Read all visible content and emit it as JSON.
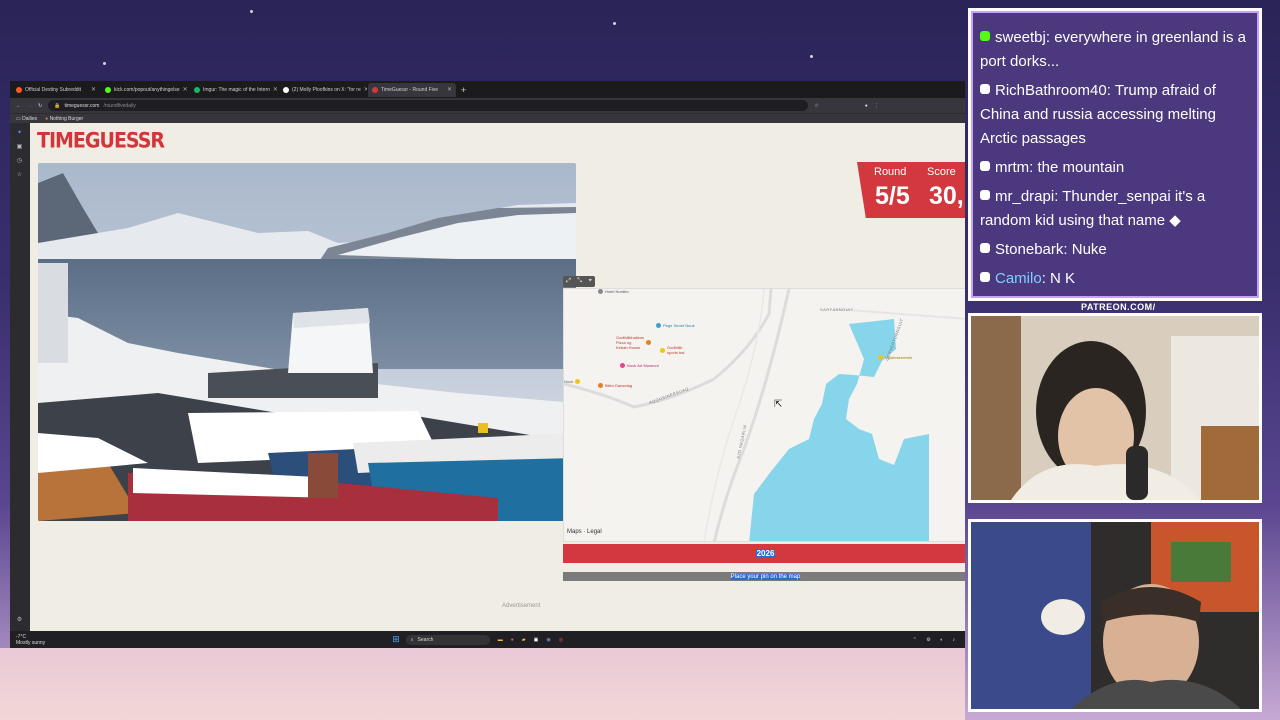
{
  "browser": {
    "tabs": [
      {
        "label": "Official Destiny Subreddit",
        "color": "#ff5a1f"
      },
      {
        "label": "kick.com/popout/anythingelse",
        "color": "#53fc18"
      },
      {
        "label": "Imgur: The magic of the Intern",
        "color": "#1bb76e"
      },
      {
        "label": "(2) Molly Ploofkins on X: \"for re",
        "color": "#ffffff"
      },
      {
        "label": "TimeGuessr - Round Five",
        "color": "#d2383d"
      }
    ],
    "url_host": "timeguessr.com",
    "url_path": "/roundfivedaily",
    "bookmarks": [
      "Dailies",
      "Nothing Burger"
    ]
  },
  "game": {
    "logo": "TIMEGUESSR",
    "round_label": "Round",
    "score_label": "Score",
    "round_value": "5/5",
    "score_value": "30,",
    "year": "2026",
    "place_prompt_highlight": "Place your p",
    "place_prompt_rest": "in on the map",
    "advertisement": "Advertisement",
    "map_attribution": "Maps",
    "map_legal": "Legal",
    "map_pois": [
      {
        "label": "Hotel Nordbo",
        "color": "#888888"
      },
      {
        "label": "Pege Smart Nuuk",
        "color": "#3a9fd6"
      },
      {
        "label": "Godthåbhallens\nPizza og\nKebab House",
        "color": "#e67e22"
      },
      {
        "label": "Godthåb\nsports bal",
        "color": "#f1c40f"
      },
      {
        "label": "Nuuk Art Museum",
        "color": "#e84393"
      },
      {
        "label": "Bitim Dansetag",
        "color": "#e67e22"
      },
      {
        "label": "Holdersenetrek",
        "color": "#f1c40f"
      },
      {
        "label": "Nuuk",
        "color": "#888888"
      }
    ],
    "map_streets": [
      "SARFAANGUIT",
      "QERNERTUNNGUIT",
      "AQQUSINERSUAQ",
      "AJO NEQARLIK"
    ]
  },
  "taskbar": {
    "weather_temp": "-7°C",
    "weather_text": "Mostly sunny",
    "search_label": "Search"
  },
  "chat": {
    "messages": [
      {
        "user": "sweetbj",
        "text": "everywhere in greenland is a port dorks...",
        "badge": "#53fc18",
        "user_color": "#ffffff"
      },
      {
        "user": "RichBathroom40",
        "text": "Trump afraid of China and russia accessing melting Arctic passages",
        "badge": "#ffffff",
        "user_color": "#ffffff"
      },
      {
        "user": "mrtm",
        "text": "the mountain",
        "badge": "#ffffff",
        "user_color": "#ffffff"
      },
      {
        "user": "mr_drapi",
        "text": "Thunder_senpai it's a random kid using that name",
        "badge": "#ffffff",
        "user_color": "#ffffff"
      },
      {
        "user": "Stonebark",
        "text": "Nuke",
        "badge": "#ffffff",
        "user_color": "#ffffff"
      },
      {
        "user": "Camilo",
        "text": "N  K",
        "badge": "#ffffff",
        "user_color": "#7fd0ff"
      }
    ]
  },
  "overlay": {
    "patreon": "PATREON.COM/"
  }
}
